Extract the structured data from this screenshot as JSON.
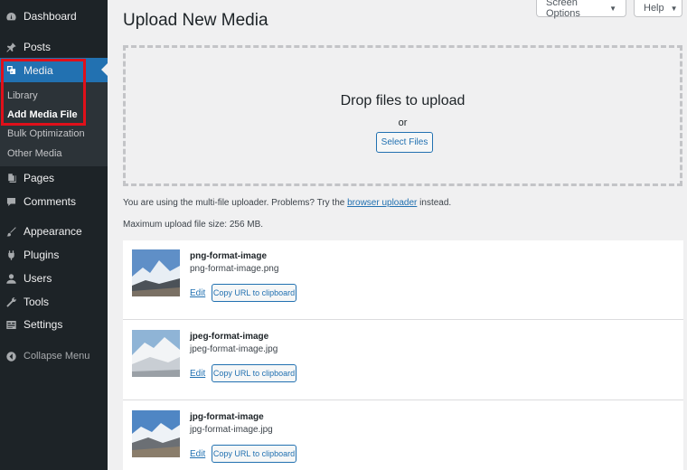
{
  "sidebar": {
    "items": [
      {
        "label": "Dashboard",
        "icon": "dashboard-icon"
      },
      {
        "label": "Posts",
        "icon": "pin-icon"
      },
      {
        "label": "Media",
        "icon": "media-icon"
      },
      {
        "label": "Pages",
        "icon": "pages-icon"
      },
      {
        "label": "Comments",
        "icon": "comment-icon"
      },
      {
        "label": "Appearance",
        "icon": "brush-icon"
      },
      {
        "label": "Plugins",
        "icon": "plug-icon"
      },
      {
        "label": "Users",
        "icon": "user-icon"
      },
      {
        "label": "Tools",
        "icon": "wrench-icon"
      },
      {
        "label": "Settings",
        "icon": "settings-icon"
      }
    ],
    "submenu": [
      "Library",
      "Add Media File",
      "Bulk Optimization",
      "Other Media"
    ],
    "collapse_label": "Collapse Menu",
    "highlight_color": "#e0101a",
    "accent_color": "#2271b1"
  },
  "header": {
    "title": "Upload New Media",
    "screen_options": "Screen Options",
    "help": "Help"
  },
  "uploader": {
    "drop_title": "Drop files to upload",
    "or": "or",
    "select_button": "Select Files",
    "notice_pre": "You are using the multi-file uploader. Problems? Try the",
    "notice_link": "browser uploader",
    "notice_post": "instead.",
    "max_size": "Maximum upload file size: 256 MB."
  },
  "media_items": [
    {
      "title": "png-format-image",
      "filename": "png-format-image.png",
      "edit": "Edit",
      "copy": "Copy URL to clipboard"
    },
    {
      "title": "jpeg-format-image",
      "filename": "jpeg-format-image.jpg",
      "edit": "Edit",
      "copy": "Copy URL to clipboard"
    },
    {
      "title": "jpg-format-image",
      "filename": "jpg-format-image.jpg",
      "edit": "Edit",
      "copy": "Copy URL to clipboard"
    }
  ]
}
